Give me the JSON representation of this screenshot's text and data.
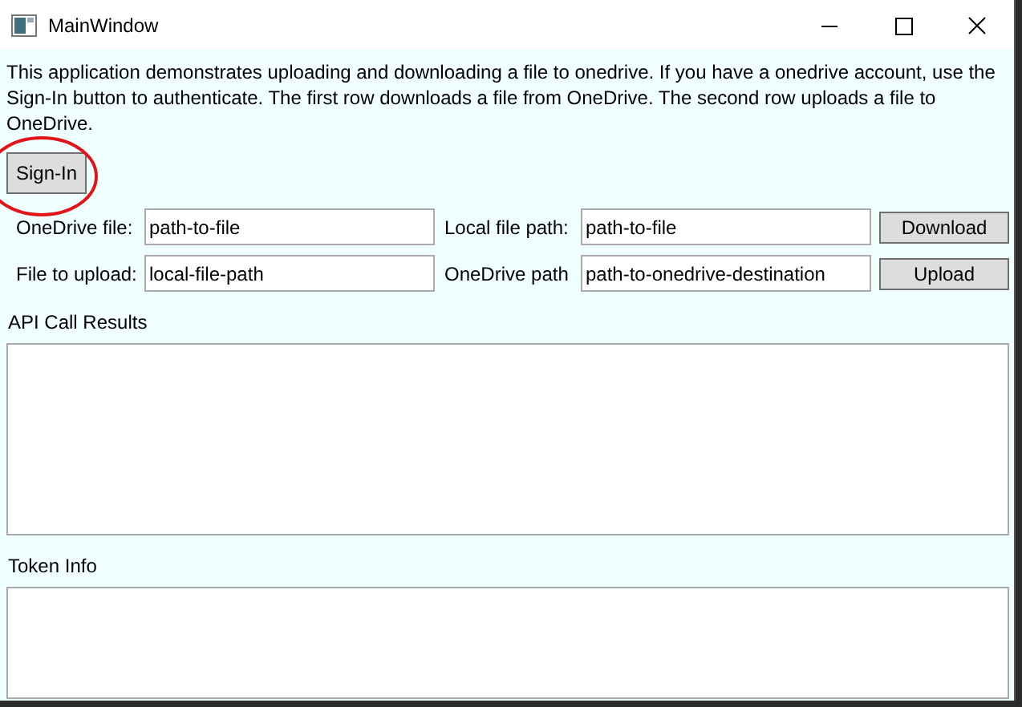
{
  "window": {
    "title": "MainWindow"
  },
  "description": "This application demonstrates uploading and downloading a file to onedrive. If you have a onedrive account, use the Sign-In button to authenticate. The first row downloads a file from OneDrive. The second row uploads a file to OneDrive.",
  "sign_in_button": {
    "label": "Sign-In",
    "highlighted": true
  },
  "transfer_rows": [
    {
      "source_label": "OneDrive file:",
      "source_value": "path-to-file",
      "target_label": "Local file path:",
      "target_value": "path-to-file",
      "button": "Download"
    },
    {
      "source_label": "File to upload:",
      "source_value": "local-file-path",
      "target_label": "OneDrive path",
      "target_value": "path-to-onedrive-destination",
      "button": "Upload"
    }
  ],
  "output_boxes": [
    {
      "label": "API Call Results"
    },
    {
      "label": "Token Info"
    }
  ]
}
